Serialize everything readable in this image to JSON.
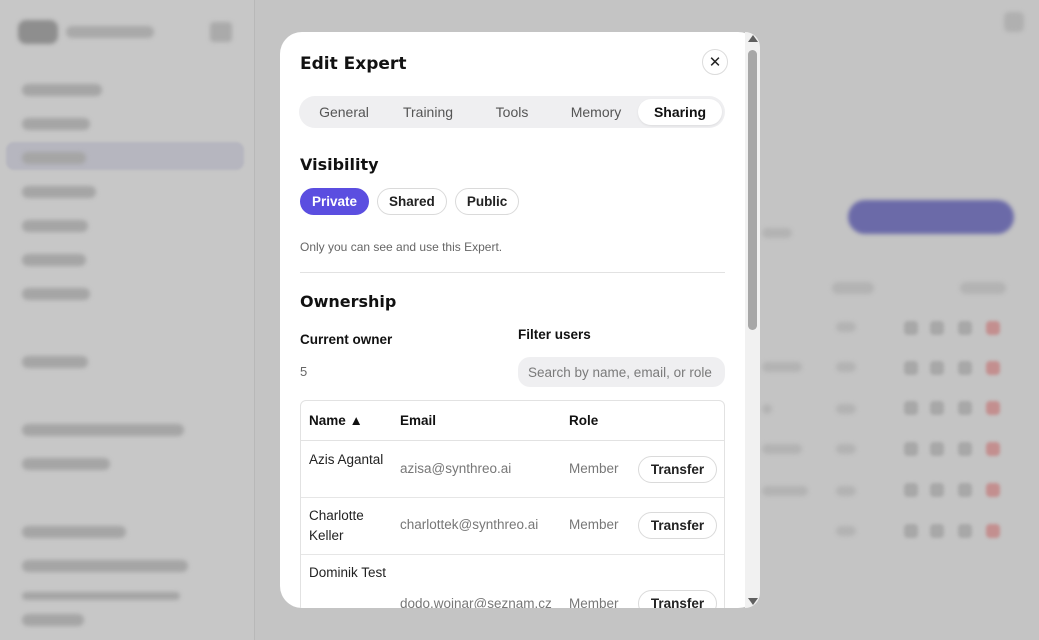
{
  "modal": {
    "title": "Edit Expert",
    "close_glyph": "✕",
    "tabs": [
      {
        "label": "General"
      },
      {
        "label": "Training"
      },
      {
        "label": "Tools"
      },
      {
        "label": "Memory"
      },
      {
        "label": "Sharing",
        "active": true
      }
    ]
  },
  "visibility": {
    "title": "Visibility",
    "options": [
      {
        "label": "Private",
        "selected": true
      },
      {
        "label": "Shared"
      },
      {
        "label": "Public"
      }
    ],
    "description": "Only you can see and use this Expert."
  },
  "ownership": {
    "title": "Ownership",
    "current_owner_label": "Current owner",
    "current_owner_value": "5",
    "filter_label": "Filter users",
    "filter_placeholder": "Search by name, email, or role",
    "filter_value": ""
  },
  "users_table": {
    "headers": {
      "name": "Name ▲",
      "email": "Email",
      "role": "Role"
    },
    "rows": [
      {
        "name": "Azis Agantal",
        "email": "azisa@synthreo.ai",
        "role": "Member",
        "action": "Transfer"
      },
      {
        "name": "Charlotte Keller",
        "email": "charlottek@synthreo.ai",
        "role": "Member",
        "action": "Transfer"
      },
      {
        "name": "Dominik Test",
        "email": "dodo.wojnar@seznam.cz",
        "role": "Member",
        "action": "Transfer"
      }
    ]
  },
  "colors": {
    "accent": "#5b4ee0",
    "overlay_background": "#c4c4c4",
    "modal_background": "#ffffff"
  },
  "icons": {
    "close": "close-icon",
    "scroll_up": "scroll-up-arrow-icon",
    "scroll_down": "scroll-down-arrow-icon"
  }
}
